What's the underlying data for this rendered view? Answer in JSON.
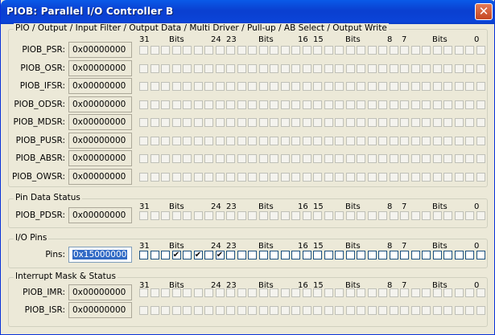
{
  "window": {
    "title": "PIOB: Parallel I/O Controller B",
    "close_glyph": "✕"
  },
  "bit_header": {
    "h31": "31",
    "bits1": "Bits",
    "h24": "24",
    "h23": "23",
    "bits2": "Bits",
    "h16": "16",
    "h15": "15",
    "bits3": "Bits",
    "h8": "8",
    "h7": "7",
    "bits4": "Bits",
    "h0": "0"
  },
  "groups": {
    "pio": {
      "title": "PIO / Output / Input Filter / Output Data / Multi Driver / Pull-up / AB Select / Output Write",
      "registers": [
        {
          "label": "PIOB_PSR:",
          "value": "0x00000000"
        },
        {
          "label": "PIOB_OSR:",
          "value": "0x00000000"
        },
        {
          "label": "PIOB_IFSR:",
          "value": "0x00000000"
        },
        {
          "label": "PIOB_ODSR:",
          "value": "0x00000000"
        },
        {
          "label": "PIOB_MDSR:",
          "value": "0x00000000"
        },
        {
          "label": "PIOB_PUSR:",
          "value": "0x00000000"
        },
        {
          "label": "PIOB_ABSR:",
          "value": "0x00000000"
        },
        {
          "label": "PIOB_OWSR:",
          "value": "0x00000000"
        }
      ]
    },
    "pin_data": {
      "title": "Pin Data Status",
      "registers": [
        {
          "label": "PIOB_PDSR:",
          "value": "0x00000000"
        }
      ]
    },
    "io_pins": {
      "title": "I/O Pins",
      "registers": [
        {
          "label": "Pins:",
          "value": "0x15000000",
          "checked_bits": [
            28,
            26,
            24
          ],
          "check_glyph": "✔"
        }
      ]
    },
    "interrupt": {
      "title": "Interrupt Mask & Status",
      "registers": [
        {
          "label": "PIOB_IMR:",
          "value": "0x00000000"
        },
        {
          "label": "PIOB_ISR:",
          "value": "0x00000000"
        }
      ]
    }
  }
}
